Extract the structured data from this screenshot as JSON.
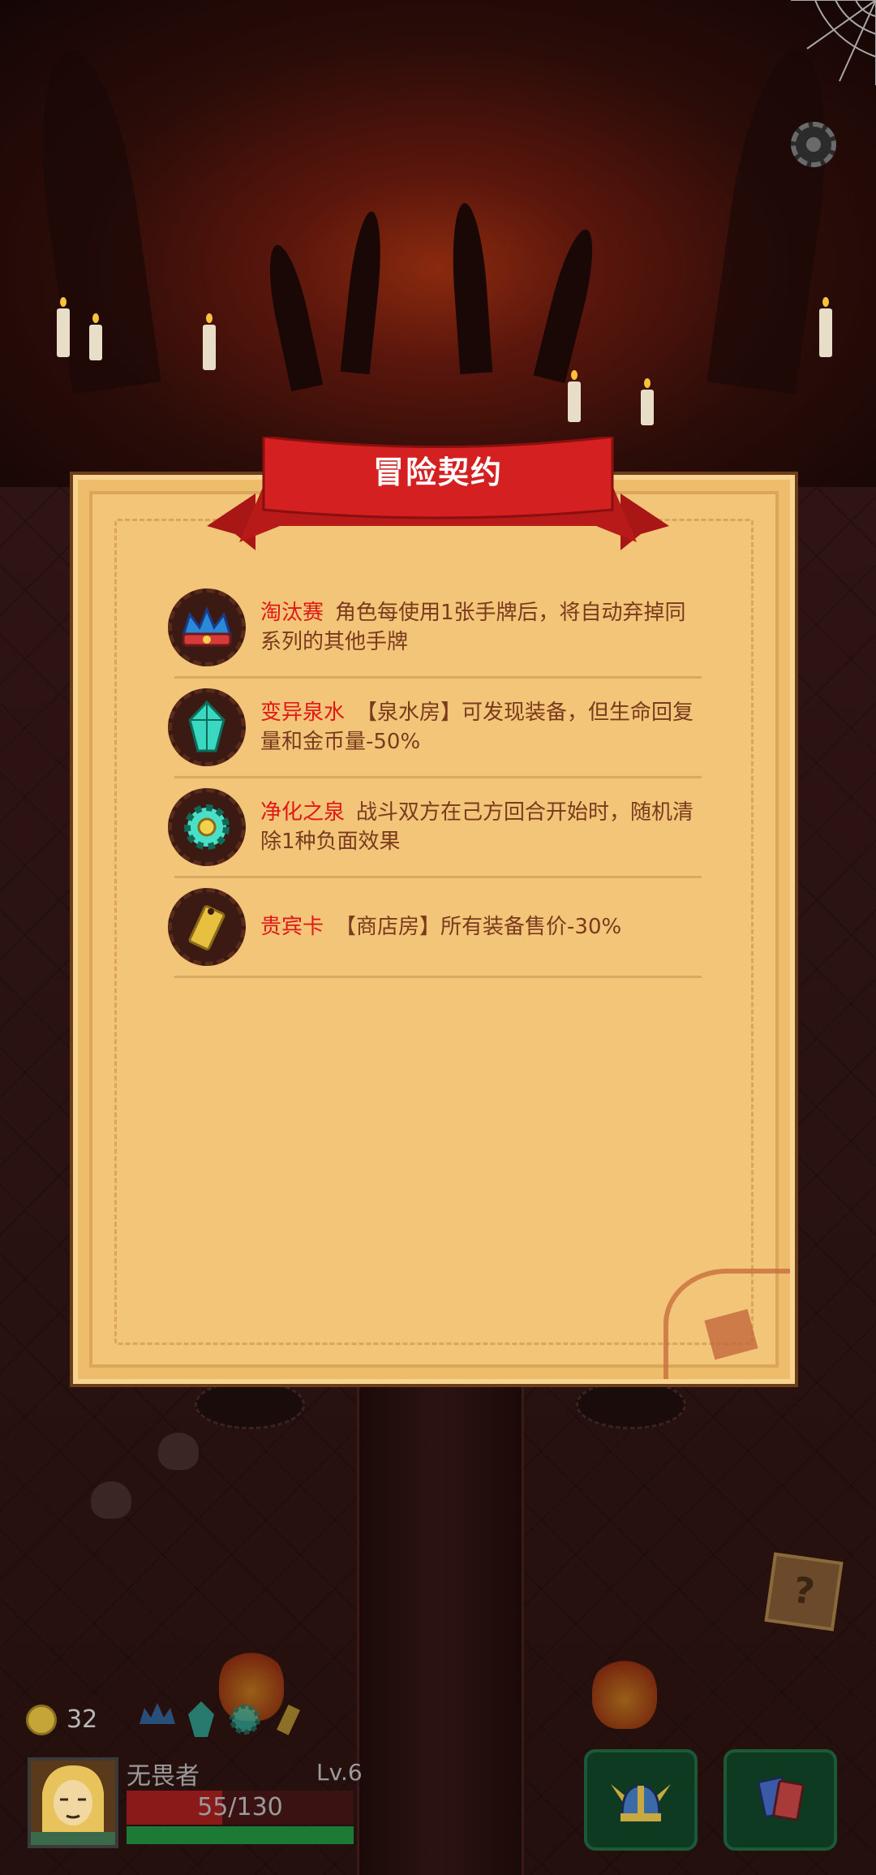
{
  "panel": {
    "title": "冒险契约",
    "contracts": [
      {
        "name": "淘汰赛",
        "description": "角色每使用1张手牌后，将自动弃掉同系列的其他手牌",
        "icon": "crown-icon"
      },
      {
        "name": "变异泉水",
        "description": "【泉水房】可发现装备，但生命回复量和金币量-50%",
        "icon": "crystal-icon"
      },
      {
        "name": "净化之泉",
        "description": "战斗双方在己方回合开始时，随机清除1种负面效果",
        "icon": "gear-icon"
      },
      {
        "name": "贵宾卡",
        "description": "【商店房】所有装备售价-30%",
        "icon": "ticket-icon"
      }
    ]
  },
  "hud": {
    "gold": "32",
    "player_name": "无畏者",
    "level": "Lv.6",
    "hp_text": "55/130",
    "hp_fraction": 0.42,
    "xp_fraction": 1.0,
    "mystery_box": "?"
  },
  "colors": {
    "ribbon": "#d42020",
    "contract_name": "#e01818",
    "parchment": "#f2c578"
  }
}
